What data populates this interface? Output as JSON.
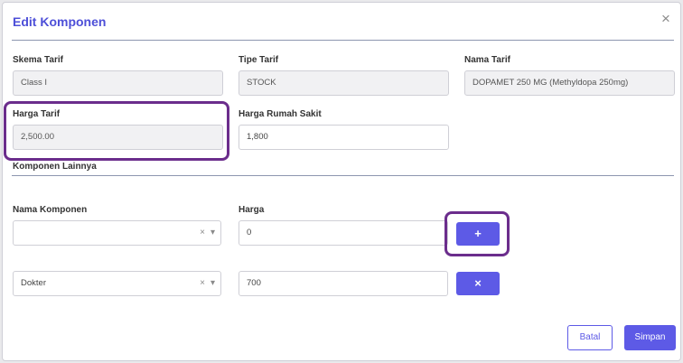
{
  "modal": {
    "title": "Edit Komponen",
    "close_icon": "×"
  },
  "fields": {
    "skema_tarif": {
      "label": "Skema Tarif",
      "value": "Class I"
    },
    "tipe_tarif": {
      "label": "Tipe Tarif",
      "value": "STOCK"
    },
    "nama_tarif": {
      "label": "Nama Tarif",
      "value": "DOPAMET 250 MG (Methyldopa 250mg)"
    },
    "harga_tarif": {
      "label": "Harga Tarif",
      "value": "2,500.00"
    },
    "harga_rumah_sakit": {
      "label": "Harga Rumah Sakit",
      "value": "1,800"
    }
  },
  "komponen": {
    "section_title": "Komponen Lainnya",
    "nama_label": "Nama Komponen",
    "harga_label": "Harga",
    "new_row": {
      "nama": "",
      "harga": "0",
      "button_icon": "+"
    },
    "rows": [
      {
        "nama": "Dokter",
        "harga": "700",
        "button_icon": "×"
      }
    ]
  },
  "select_controls": {
    "clear_icon": "×",
    "caret_icon": "▾"
  },
  "footer": {
    "cancel_label": "Batal",
    "save_label": "Simpan"
  },
  "colors": {
    "accent": "#5d5ae6",
    "title": "#4d4fd8",
    "highlight": "#6b2d8c"
  }
}
